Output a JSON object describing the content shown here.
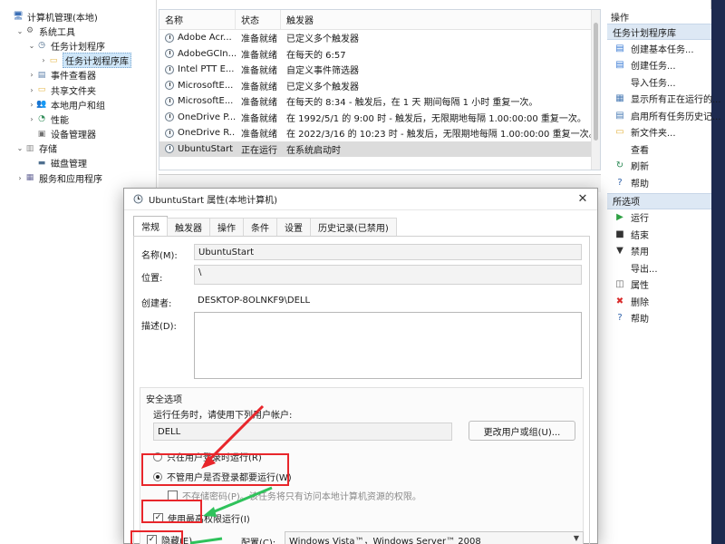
{
  "tree": {
    "items": [
      {
        "label": "计算机管理(本地)",
        "indent": 0,
        "arrow": "",
        "icon": "computer"
      },
      {
        "label": "系统工具",
        "indent": 1,
        "arrow": "⌄",
        "icon": "tools"
      },
      {
        "label": "任务计划程序",
        "indent": 2,
        "arrow": "⌄",
        "icon": "clock"
      },
      {
        "label": "任务计划程序库",
        "indent": 3,
        "arrow": "›",
        "icon": "folder",
        "selected": true
      },
      {
        "label": "事件查看器",
        "indent": 2,
        "arrow": "›",
        "icon": "log"
      },
      {
        "label": "共享文件夹",
        "indent": 2,
        "arrow": "›",
        "icon": "folder"
      },
      {
        "label": "本地用户和组",
        "indent": 2,
        "arrow": "›",
        "icon": "users"
      },
      {
        "label": "性能",
        "indent": 2,
        "arrow": "›",
        "icon": "perf"
      },
      {
        "label": "设备管理器",
        "indent": 2,
        "arrow": "",
        "icon": "device"
      },
      {
        "label": "存储",
        "indent": 1,
        "arrow": "⌄",
        "icon": "storage"
      },
      {
        "label": "磁盘管理",
        "indent": 2,
        "arrow": "",
        "icon": "disk"
      },
      {
        "label": "服务和应用程序",
        "indent": 1,
        "arrow": "›",
        "icon": "services"
      }
    ]
  },
  "list": {
    "headers": {
      "name": "名称",
      "status": "状态",
      "trigger": "触发器"
    },
    "rows": [
      {
        "name": "Adobe Acr...",
        "status": "准备就绪",
        "trigger": "已定义多个触发器"
      },
      {
        "name": "AdobeGCIn...",
        "status": "准备就绪",
        "trigger": "在每天的 6:57"
      },
      {
        "name": "Intel PTT E...",
        "status": "准备就绪",
        "trigger": "自定义事件筛选器"
      },
      {
        "name": "MicrosoftE...",
        "status": "准备就绪",
        "trigger": "已定义多个触发器"
      },
      {
        "name": "MicrosoftE...",
        "status": "准备就绪",
        "trigger": "在每天的 8:34 - 触发后，在 1 天 期间每隔 1 小时 重复一次。"
      },
      {
        "name": "OneDrive P...",
        "status": "准备就绪",
        "trigger": "在 1992/5/1 的 9:00 时 - 触发后，无限期地每隔 1.00:00:00 重复一次。"
      },
      {
        "name": "OneDrive R...",
        "status": "准备就绪",
        "trigger": "在 2022/3/16 的 10:23 时 - 触发后，无限期地每隔 1.00:00:00 重复一次。"
      },
      {
        "name": "UbuntuStart",
        "status": "正在运行",
        "trigger": "在系统启动时",
        "selected": true
      }
    ]
  },
  "actions": {
    "title": "操作",
    "section1_header": "任务计划程序库",
    "section1_items": [
      {
        "label": "创建基本任务...",
        "icon": "create-basic-task-icon"
      },
      {
        "label": "创建任务...",
        "icon": "create-task-icon"
      },
      {
        "label": "导入任务...",
        "icon": "import-icon"
      },
      {
        "label": "显示所有正在运行的...",
        "icon": "running-tasks-icon"
      },
      {
        "label": "启用所有任务历史记...",
        "icon": "history-icon"
      },
      {
        "label": "新文件夹...",
        "icon": "new-folder-icon"
      },
      {
        "label": "查看",
        "icon": "view-icon"
      },
      {
        "label": "刷新",
        "icon": "refresh-icon"
      },
      {
        "label": "帮助",
        "icon": "help-icon"
      }
    ],
    "section2_header": "所选项",
    "section2_items": [
      {
        "label": "运行",
        "icon": "run-icon"
      },
      {
        "label": "结束",
        "icon": "end-icon"
      },
      {
        "label": "禁用",
        "icon": "disable-icon"
      },
      {
        "label": "导出...",
        "icon": "export-icon"
      },
      {
        "label": "属性",
        "icon": "properties-icon"
      },
      {
        "label": "删除",
        "icon": "delete-icon"
      },
      {
        "label": "帮助",
        "icon": "help-icon"
      }
    ]
  },
  "dialog": {
    "title": "UbuntuStart 属性(本地计算机)",
    "close": "✕",
    "tabs": [
      "常规",
      "触发器",
      "操作",
      "条件",
      "设置",
      "历史记录(已禁用)"
    ],
    "name_label": "名称(M):",
    "name_value": "UbuntuStart",
    "location_label": "位置:",
    "location_value": "\\",
    "author_label": "创建者:",
    "author_value": "DESKTOP-8OLNKF9\\DELL",
    "desc_label": "描述(D):",
    "security_title": "安全选项",
    "run_as_label": "运行任务时，请使用下列用户帐户:",
    "run_as_value": "DELL",
    "change_user_button": "更改用户或组(U)...",
    "radio_logged_on": "只在用户登录时运行(R)",
    "radio_whether": "不管用户是否登录都要运行(W)",
    "no_store_password": "不存储密码(P)。该任务将只有访问本地计算机资源的权限。",
    "highest_privileges": "使用最高权限运行(I)",
    "hidden": "隐藏(E)",
    "configure_label": "配置(C):",
    "configure_value": "Windows Vista™，Windows Server™ 2008"
  },
  "colors": {
    "highlight": "#e8262b",
    "arrow_red": "#e8262b",
    "arrow_green": "#2fc25b"
  }
}
